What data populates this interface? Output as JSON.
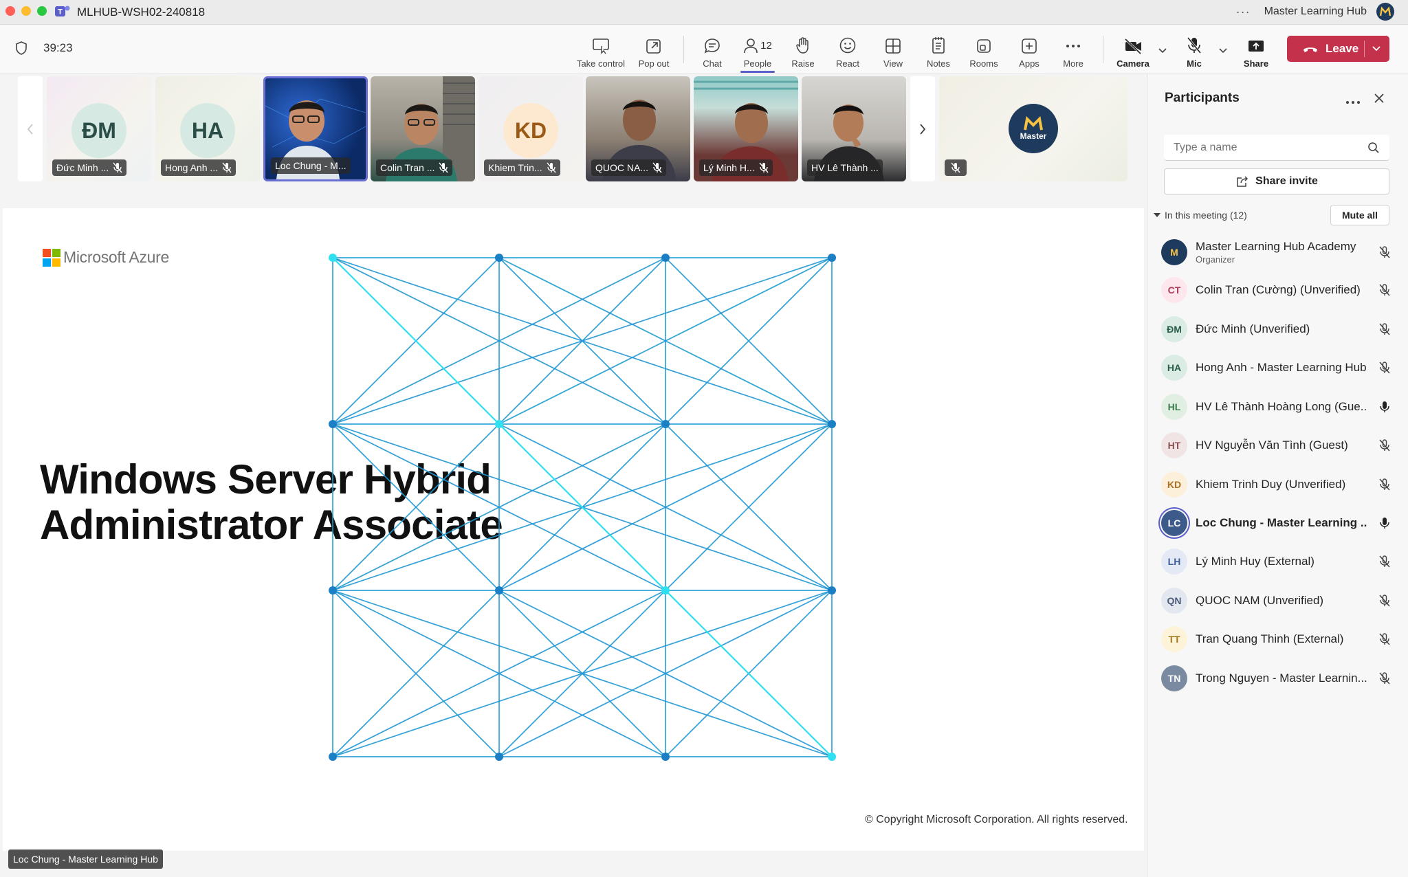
{
  "window": {
    "title": "MLHUB-WSH02-240818",
    "more": "···",
    "org_name": "Master Learning Hub"
  },
  "toolbar": {
    "timer": "39:23",
    "buttons": [
      {
        "label": "Take control",
        "icon": "take-control-icon"
      },
      {
        "label": "Pop out",
        "icon": "pop-out-icon"
      },
      {
        "label": "Chat",
        "icon": "chat-icon"
      },
      {
        "label": "People",
        "icon": "people-icon",
        "count": "12"
      },
      {
        "label": "Raise",
        "icon": "hand-icon"
      },
      {
        "label": "React",
        "icon": "smile-icon"
      },
      {
        "label": "View",
        "icon": "grid-icon"
      },
      {
        "label": "Notes",
        "icon": "notes-icon"
      },
      {
        "label": "Rooms",
        "icon": "rooms-icon"
      },
      {
        "label": "Apps",
        "icon": "apps-icon"
      },
      {
        "label": "More",
        "icon": "more-icon"
      },
      {
        "label": "Camera",
        "icon": "camera-off-icon"
      },
      {
        "label": "Mic",
        "icon": "mic-off-icon"
      },
      {
        "label": "Share",
        "icon": "share-icon"
      }
    ],
    "leave": "Leave"
  },
  "gallery": [
    {
      "name": "Đức Minh ...",
      "initials": "ĐM",
      "type": "avatar"
    },
    {
      "name": "Hong Anh ...",
      "initials": "HA",
      "type": "avatar"
    },
    {
      "name": "Loc Chung - M...",
      "type": "video"
    },
    {
      "name": "Colin Tran ...",
      "type": "video"
    },
    {
      "name": "Khiem Trin...",
      "initials": "KD",
      "type": "avatar"
    },
    {
      "name": "QUOC NA...",
      "type": "video"
    },
    {
      "name": "Lý Minh H...",
      "type": "video"
    },
    {
      "name": "HV Lê Thành ...",
      "type": "video"
    }
  ],
  "self_tile": {
    "logo_text": "Master"
  },
  "slide": {
    "brand": "Microsoft Azure",
    "title_line1": "Windows Server Hybrid",
    "title_line2": "Administrator Associate",
    "copyright": "© Copyright Microsoft Corporation. All rights reserved."
  },
  "presenter": "Loc Chung - Master Learning Hub",
  "participants": {
    "title": "Participants",
    "search_placeholder": "Type a name",
    "share_invite": "Share invite",
    "section": "In this meeting (12)",
    "mute_all": "Mute all",
    "list": [
      {
        "name": "Master Learning Hub Academy",
        "sub": "Organizer",
        "initials": "M",
        "mic": "muted",
        "bg": "#1e3a5c",
        "fg": "#f5c243"
      },
      {
        "name": "Colin Tran (Cường) (Unverified)",
        "initials": "CT",
        "mic": "muted",
        "bg": "#fde7ec",
        "fg": "#b03a58"
      },
      {
        "name": "Đức Minh (Unverified)",
        "initials": "ĐM",
        "mic": "muted",
        "bg": "#dbece5",
        "fg": "#2a5f4c"
      },
      {
        "name": "Hong Anh - Master Learning Hub",
        "initials": "HA",
        "mic": "muted",
        "bg": "#dbece5",
        "fg": "#2a5f4c"
      },
      {
        "name": "HV Lê Thành Hoàng Long (Gue...",
        "initials": "HL",
        "mic": "on",
        "bg": "#e1efe3",
        "fg": "#3b7a4c"
      },
      {
        "name": "HV Nguyễn Văn Tình (Guest)",
        "initials": "HT",
        "mic": "muted",
        "bg": "#f0e4e4",
        "fg": "#8a4f4f"
      },
      {
        "name": "Khiem Trinh Duy (Unverified)",
        "initials": "KD",
        "mic": "muted",
        "bg": "#fdf0db",
        "fg": "#b07020"
      },
      {
        "name": "Loc Chung - Master Learning ...",
        "initials": "LC",
        "mic": "on",
        "bold": true,
        "bg": "#3c5a8a",
        "fg": "#ffffff"
      },
      {
        "name": "Lý Minh Huy (External)",
        "initials": "LH",
        "mic": "muted",
        "bg": "#e3eaf6",
        "fg": "#3d5f9a"
      },
      {
        "name": "QUOC NAM (Unverified)",
        "initials": "QN",
        "mic": "muted",
        "bg": "#e3e7f0",
        "fg": "#4a5a7a"
      },
      {
        "name": "Tran Quang Thinh (External)",
        "initials": "TT",
        "mic": "muted",
        "bg": "#fdf3d8",
        "fg": "#a47a1a"
      },
      {
        "name": "Trong Nguyen - Master Learnin...",
        "initials": "TN",
        "mic": "muted",
        "bg": "#7a8aa0",
        "fg": "#ffffff"
      }
    ]
  },
  "colors": {
    "accent": "#5b5fc7",
    "leave": "#c4314b",
    "network": "#1f98d4",
    "network_highlight": "#2ee0f0"
  }
}
